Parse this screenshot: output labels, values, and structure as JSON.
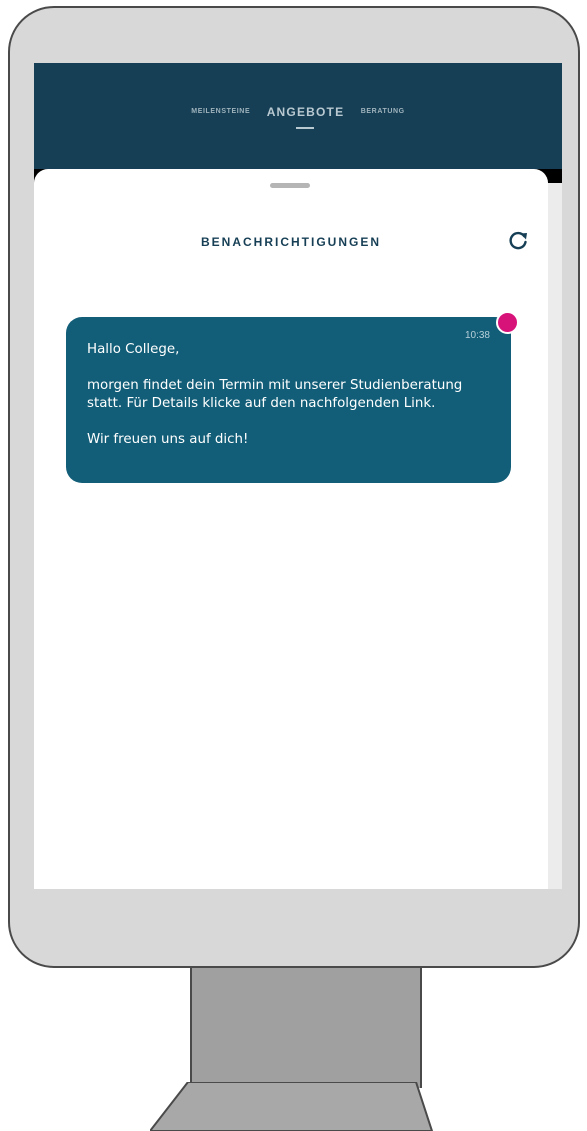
{
  "nav": {
    "items": [
      {
        "label": "MEILENSTEINE"
      },
      {
        "label": "ANGEBOTE"
      },
      {
        "label": "BERATUNG"
      }
    ],
    "active_item": "ANGEBOTE"
  },
  "notifications": {
    "title": "BENACHRICHTIGUNGEN",
    "refresh_icon": "refresh-icon",
    "messages": [
      {
        "time": "10:38",
        "unread": true,
        "greeting": "Hallo College,",
        "body_line1": "morgen findet dein Termin mit unserer Studienberatung",
        "body_line2": "statt. Für Details klicke auf den nachfolgenden Link.",
        "closing": "Wir freuen uns auf dich!"
      }
    ]
  },
  "colors": {
    "header_bg": "#163f55",
    "message_bg": "#125e78",
    "unread_dot": "#d7137a",
    "title_text": "#163f55"
  }
}
